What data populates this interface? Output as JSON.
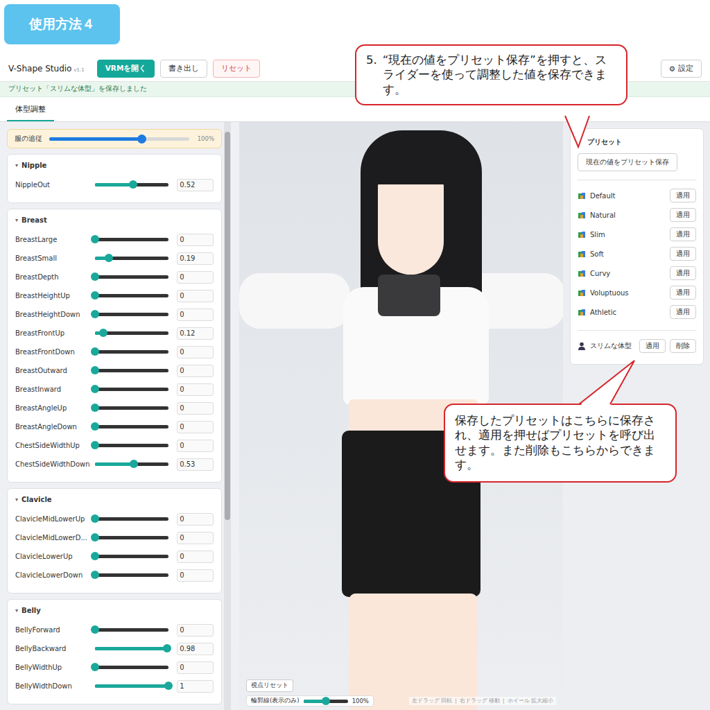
{
  "badge": "使用方法４",
  "app": {
    "title": "V-Shape Studio",
    "version": "v1.1"
  },
  "toolbar": {
    "buttons": [
      {
        "label": "VRMを開く",
        "kind": "primary"
      },
      {
        "label": "書き出し",
        "kind": "default"
      },
      {
        "label": "リセット",
        "kind": "danger"
      }
    ],
    "settings": {
      "icon": "⚙",
      "label": "設定"
    }
  },
  "notice": "プリセット「スリムな体型」を保存しました",
  "tabs": [
    {
      "label": "体型調整",
      "selected": true
    }
  ],
  "follow": {
    "label": "服の追従",
    "level": 0.66,
    "reading": "100%"
  },
  "sections": [
    {
      "title": "Nipple",
      "icon": "▾",
      "expanded": true,
      "sliders": [
        {
          "label": "NippleOut",
          "level": 0.52,
          "value": "0.52"
        }
      ]
    },
    {
      "title": "Breast",
      "icon": "▾",
      "expanded": true,
      "sliders": [
        {
          "label": "BreastLarge",
          "level": 0,
          "value": "0"
        },
        {
          "label": "BreastSmall",
          "level": 0.19,
          "value": "0.19"
        },
        {
          "label": "BreastDepth",
          "level": 0,
          "value": "0"
        },
        {
          "label": "BreastHeightUp",
          "level": 0,
          "value": "0"
        },
        {
          "label": "BreastHeightDown",
          "level": 0,
          "value": "0"
        },
        {
          "label": "BreastFrontUp",
          "level": 0.12,
          "value": "0.12"
        },
        {
          "label": "BreastFrontDown",
          "level": 0,
          "value": "0"
        },
        {
          "label": "BreastOutward",
          "level": 0,
          "value": "0"
        },
        {
          "label": "BreastInward",
          "level": 0,
          "value": "0"
        },
        {
          "label": "BreastAngleUp",
          "level": 0,
          "value": "0"
        },
        {
          "label": "BreastAngleDown",
          "level": 0,
          "value": "0"
        },
        {
          "label": "ChestSideWidthUp",
          "level": 0,
          "value": "0"
        },
        {
          "label": "ChestSideWidthDown",
          "level": 0.53,
          "value": "0.53"
        }
      ]
    },
    {
      "title": "Clavicle",
      "icon": "▾",
      "expanded": true,
      "sliders": [
        {
          "label": "ClavicleMidLowerUp",
          "level": 0,
          "value": "0"
        },
        {
          "label": "ClavicleMidLowerD...",
          "level": 0,
          "value": "0"
        },
        {
          "label": "ClavicleLowerUp",
          "level": 0,
          "value": "0"
        },
        {
          "label": "ClavicleLowerDown",
          "level": 0,
          "value": "0"
        }
      ]
    },
    {
      "title": "Belly",
      "icon": "▾",
      "expanded": true,
      "sliders": [
        {
          "label": "BellyForward",
          "level": 0,
          "value": "0"
        },
        {
          "label": "BellyBackward",
          "level": 0.98,
          "value": "0.98"
        },
        {
          "label": "BellyWidthUp",
          "level": 0,
          "value": "0"
        },
        {
          "label": "BellyWidthDown",
          "level": 1,
          "value": "1"
        }
      ]
    }
  ],
  "viewport": {
    "reset_button": "視点リセット",
    "outline": {
      "label": "輪郭線(表示のみ)",
      "level": 0.5,
      "reading": "100%"
    },
    "hints": [
      "左ドラッグ 回転",
      "右ドラッグ 移動",
      "ホイール 拡大縮小"
    ],
    "hint_separator": "|"
  },
  "presets": {
    "title": "プリセット",
    "save_button": "現在の値をプリセット保存",
    "items": [
      {
        "name": "Default",
        "kind": "builtin",
        "apply": "適用"
      },
      {
        "name": "Natural",
        "kind": "builtin",
        "apply": "適用"
      },
      {
        "name": "Slim",
        "kind": "builtin",
        "apply": "適用"
      },
      {
        "name": "Soft",
        "kind": "builtin",
        "apply": "適用"
      },
      {
        "name": "Curvy",
        "kind": "builtin",
        "apply": "適用"
      },
      {
        "name": "Voluptuous",
        "kind": "builtin",
        "apply": "適用"
      },
      {
        "name": "Athletic",
        "kind": "builtin",
        "apply": "適用"
      },
      {
        "name": "スリムな体型",
        "kind": "user",
        "apply": "適用",
        "delete": "削除"
      }
    ]
  },
  "callouts": [
    {
      "number": "5.",
      "text": "“現在の値をプリセット保存”を押すと、スライダーを使って調整した値を保存できます。"
    },
    {
      "text": "保存したプリセットはこちらに保存され、適用を押せばプリセットを呼び出せます。また削除もこちらからできます。"
    }
  ]
}
